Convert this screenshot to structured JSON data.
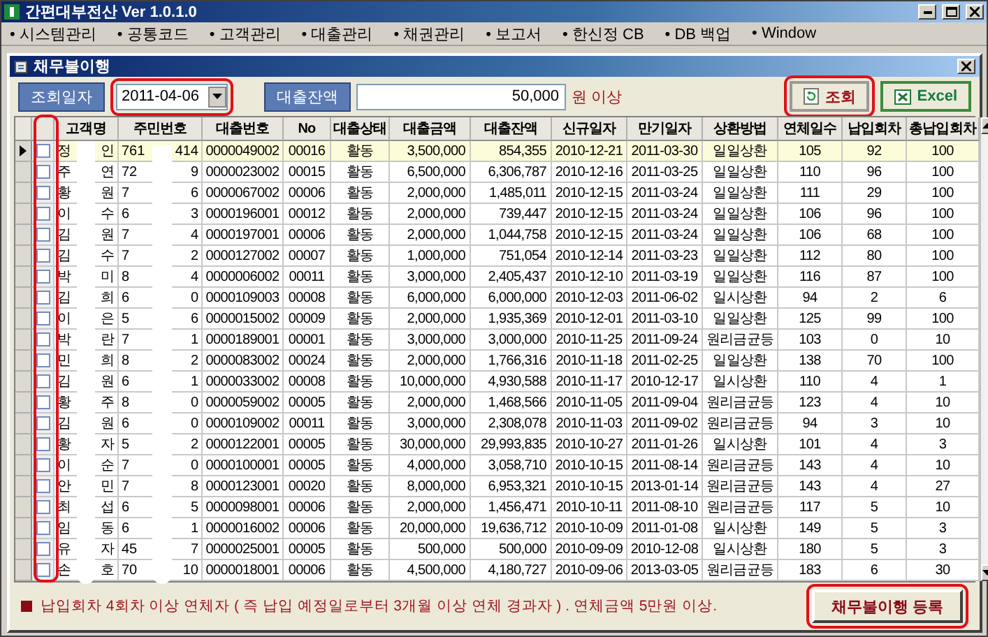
{
  "window": {
    "title": "간편대부전산 Ver 1.0.1.0"
  },
  "menu": [
    {
      "label": "• 시스템관리"
    },
    {
      "label": "• 공통코드"
    },
    {
      "label": "• 고객관리"
    },
    {
      "label": "• 대출관리"
    },
    {
      "label": "• 채권관리"
    },
    {
      "label": "• 보고서"
    },
    {
      "label": "• 한신정 CB"
    },
    {
      "label": "• DB 백업"
    },
    {
      "label": "• Window"
    }
  ],
  "child_window": {
    "title": "채무불이행"
  },
  "filters": {
    "date_label": "조회일자",
    "date_value": "2011-04-06",
    "balance_label": "대출잔액",
    "balance_value": "50,000",
    "balance_suffix": "원 이상"
  },
  "actions": [
    {
      "kind": "search",
      "label": "조회"
    },
    {
      "kind": "excel",
      "label": "Excel"
    }
  ],
  "table": {
    "columns": [
      "고객명",
      "주민번호",
      "대출번호",
      "No",
      "대출상태",
      "대출금액",
      "대출잔액",
      "신규일자",
      "만기일자",
      "상환방법",
      "연체일수",
      "납입회차",
      "총납입회차"
    ],
    "rows": [
      {
        "selected": true,
        "checked": false,
        "cells": [
          {
            "head": "정",
            "tail": "인"
          },
          {
            "head": "761",
            "tail": "414"
          },
          "0000049002",
          "00016",
          "활동",
          "3,500,000",
          "854,355",
          "2010-12-21",
          "2011-03-30",
          "일일상환",
          "105",
          "92",
          "100"
        ]
      },
      {
        "selected": false,
        "checked": false,
        "cells": [
          {
            "head": "주",
            "tail": "연"
          },
          {
            "head": "72",
            "tail": "9"
          },
          "0000023002",
          "00015",
          "활동",
          "6,500,000",
          "6,306,787",
          "2010-12-16",
          "2011-03-25",
          "일일상환",
          "110",
          "96",
          "100"
        ]
      },
      {
        "selected": false,
        "checked": false,
        "cells": [
          {
            "head": "황",
            "tail": "원"
          },
          {
            "head": "7",
            "tail": "6"
          },
          "0000067002",
          "00006",
          "활동",
          "2,000,000",
          "1,485,011",
          "2010-12-15",
          "2011-03-24",
          "일일상환",
          "111",
          "29",
          "100"
        ]
      },
      {
        "selected": false,
        "checked": false,
        "cells": [
          {
            "head": "이",
            "tail": "수"
          },
          {
            "head": "6",
            "tail": "3"
          },
          "0000196001",
          "00012",
          "활동",
          "2,000,000",
          "739,447",
          "2010-12-15",
          "2011-03-24",
          "일일상환",
          "106",
          "96",
          "100"
        ]
      },
      {
        "selected": false,
        "checked": false,
        "cells": [
          {
            "head": "김",
            "tail": "원"
          },
          {
            "head": "7",
            "tail": "4"
          },
          "0000197001",
          "00006",
          "활동",
          "2,000,000",
          "1,044,758",
          "2010-12-15",
          "2011-03-24",
          "일일상환",
          "106",
          "68",
          "100"
        ]
      },
      {
        "selected": false,
        "checked": false,
        "cells": [
          {
            "head": "김",
            "tail": "수"
          },
          {
            "head": "7",
            "tail": "2"
          },
          "0000127002",
          "00007",
          "활동",
          "1,000,000",
          "751,054",
          "2010-12-14",
          "2011-03-23",
          "일일상환",
          "112",
          "80",
          "100"
        ]
      },
      {
        "selected": false,
        "checked": false,
        "cells": [
          {
            "head": "박",
            "tail": "미"
          },
          {
            "head": "8",
            "tail": "4"
          },
          "0000006002",
          "00011",
          "활동",
          "3,000,000",
          "2,405,437",
          "2010-12-10",
          "2011-03-19",
          "일일상환",
          "116",
          "87",
          "100"
        ]
      },
      {
        "selected": false,
        "checked": false,
        "cells": [
          {
            "head": "김",
            "tail": "희"
          },
          {
            "head": "6",
            "tail": "0"
          },
          "0000109003",
          "00008",
          "활동",
          "6,000,000",
          "6,000,000",
          "2010-12-03",
          "2011-06-02",
          "일시상환",
          "94",
          "2",
          "6"
        ]
      },
      {
        "selected": false,
        "checked": false,
        "cells": [
          {
            "head": "이",
            "tail": "은"
          },
          {
            "head": "5",
            "tail": "6"
          },
          "0000015002",
          "00009",
          "활동",
          "2,000,000",
          "1,935,369",
          "2010-12-01",
          "2011-03-10",
          "일일상환",
          "125",
          "99",
          "100"
        ]
      },
      {
        "selected": false,
        "checked": false,
        "cells": [
          {
            "head": "박",
            "tail": "란"
          },
          {
            "head": "7",
            "tail": "1"
          },
          "0000189001",
          "00001",
          "활동",
          "3,000,000",
          "3,000,000",
          "2010-11-25",
          "2011-09-24",
          "원리금균등",
          "103",
          "0",
          "10"
        ]
      },
      {
        "selected": false,
        "checked": false,
        "cells": [
          {
            "head": "민",
            "tail": "희"
          },
          {
            "head": "8",
            "tail": "2"
          },
          "0000083002",
          "00024",
          "활동",
          "2,000,000",
          "1,766,316",
          "2010-11-18",
          "2011-02-25",
          "일일상환",
          "138",
          "70",
          "100"
        ]
      },
      {
        "selected": false,
        "checked": false,
        "cells": [
          {
            "head": "김",
            "tail": "원"
          },
          {
            "head": "6",
            "tail": "1"
          },
          "0000033002",
          "00008",
          "활동",
          "10,000,000",
          "4,930,588",
          "2010-11-17",
          "2010-12-17",
          "일시상환",
          "110",
          "4",
          "1"
        ]
      },
      {
        "selected": false,
        "checked": false,
        "cells": [
          {
            "head": "황",
            "tail": "주"
          },
          {
            "head": "8",
            "tail": "0"
          },
          "0000059002",
          "00005",
          "활동",
          "2,000,000",
          "1,468,566",
          "2010-11-05",
          "2011-09-04",
          "원리금균등",
          "123",
          "4",
          "10"
        ]
      },
      {
        "selected": false,
        "checked": false,
        "cells": [
          {
            "head": "김",
            "tail": "원"
          },
          {
            "head": "6",
            "tail": "0"
          },
          "0000109002",
          "00011",
          "활동",
          "3,000,000",
          "2,308,078",
          "2010-11-03",
          "2011-09-02",
          "원리금균등",
          "94",
          "3",
          "10"
        ]
      },
      {
        "selected": false,
        "checked": false,
        "cells": [
          {
            "head": "황",
            "tail": "자"
          },
          {
            "head": "5",
            "tail": "2"
          },
          "0000122001",
          "00005",
          "활동",
          "30,000,000",
          "29,993,835",
          "2010-10-27",
          "2011-01-26",
          "일시상환",
          "101",
          "4",
          "3"
        ]
      },
      {
        "selected": false,
        "checked": false,
        "cells": [
          {
            "head": "이",
            "tail": "순"
          },
          {
            "head": "7",
            "tail": "0"
          },
          "0000100001",
          "00005",
          "활동",
          "4,000,000",
          "3,058,710",
          "2010-10-15",
          "2011-08-14",
          "원리금균등",
          "143",
          "4",
          "10"
        ]
      },
      {
        "selected": false,
        "checked": false,
        "cells": [
          {
            "head": "안",
            "tail": "민"
          },
          {
            "head": "7",
            "tail": "8"
          },
          "0000123001",
          "00020",
          "활동",
          "8,000,000",
          "6,953,321",
          "2010-10-15",
          "2013-01-14",
          "원리금균등",
          "143",
          "4",
          "27"
        ]
      },
      {
        "selected": false,
        "checked": false,
        "cells": [
          {
            "head": "최",
            "tail": "섭"
          },
          {
            "head": "6",
            "tail": "5"
          },
          "0000098001",
          "00006",
          "활동",
          "2,000,000",
          "1,456,471",
          "2010-10-11",
          "2011-08-10",
          "원리금균등",
          "117",
          "5",
          "10"
        ]
      },
      {
        "selected": false,
        "checked": false,
        "cells": [
          {
            "head": "임",
            "tail": "동"
          },
          {
            "head": "6",
            "tail": "1"
          },
          "0000016002",
          "00006",
          "활동",
          "20,000,000",
          "19,636,712",
          "2010-10-09",
          "2011-01-08",
          "일시상환",
          "149",
          "5",
          "3"
        ]
      },
      {
        "selected": false,
        "checked": false,
        "cells": [
          {
            "head": "유",
            "tail": "자"
          },
          {
            "head": "45",
            "tail": "7"
          },
          "0000025001",
          "00005",
          "활동",
          "500,000",
          "500,000",
          "2010-09-09",
          "2010-12-08",
          "일시상환",
          "180",
          "5",
          "3"
        ]
      },
      {
        "selected": false,
        "checked": false,
        "cells": [
          {
            "head": "손",
            "tail": "호"
          },
          {
            "head": "70",
            "tail": "10"
          },
          "0000018001",
          "00006",
          "활동",
          "4,500,000",
          "4,180,727",
          "2010-09-06",
          "2013-03-05",
          "원리금균등",
          "183",
          "6",
          "30"
        ]
      }
    ]
  },
  "footer": {
    "note": "납입회차 4회차 이상 연체자 ( 즉 납입 예정일로부터 3개월 이상 연체 경과자 ) . 연체금액 5만원 이상.",
    "button": "채무불이행 등록"
  }
}
